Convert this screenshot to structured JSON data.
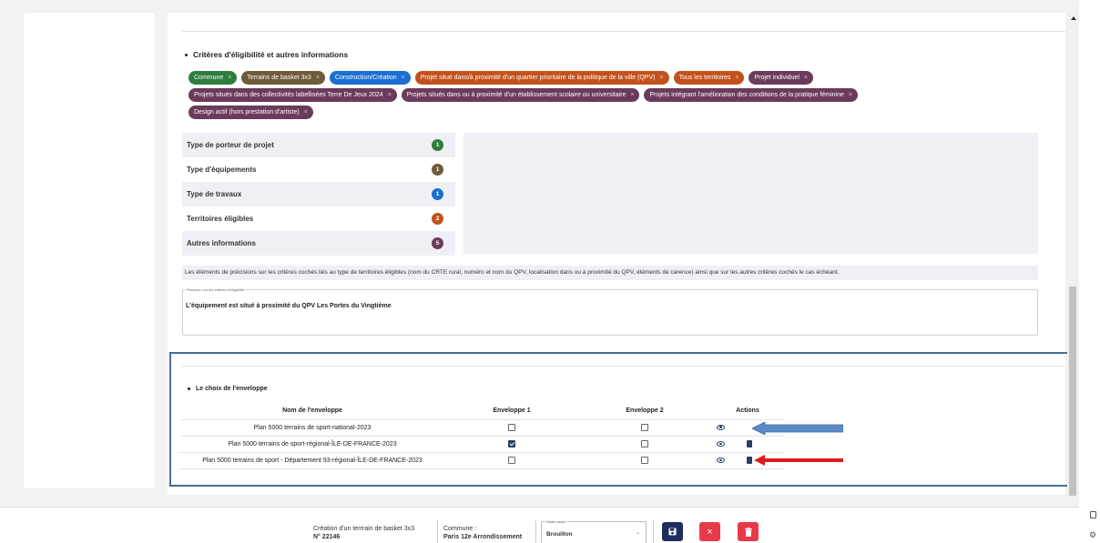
{
  "criteria_section": {
    "title": "Critères d'éligibilité et autres informations",
    "chips": [
      [
        {
          "label": "Commune",
          "color": "#2e7d3e"
        },
        {
          "label": "Terrains de basket 3x3",
          "color": "#6f5a3a"
        },
        {
          "label": "Construction/Création",
          "color": "#1a6fd1"
        },
        {
          "label": "Projet situé dans/à proximité d'un quartier prioritaire de la politique de la ville (QPV)",
          "color": "#c2521c"
        },
        {
          "label": "Tous les territoires",
          "color": "#c2521c"
        },
        {
          "label": "Projet individuel",
          "color": "#6b3b5b"
        }
      ],
      [
        {
          "label": "Projets situés dans des collectivités labellisées Terre De Jeux 2024",
          "color": "#6b3b5b"
        },
        {
          "label": "Projets situés dans ou à proximité d'un établissement scolaire ou universitaire",
          "color": "#6b3b5b"
        },
        {
          "label": "Projets intégrant l'amélioration des conditions de la pratique féminine",
          "color": "#6b3b5b"
        }
      ],
      [
        {
          "label": "Design actif (hors prestation d'artiste)",
          "color": "#6b3b5b"
        }
      ]
    ],
    "categories": [
      {
        "label": "Type de porteur de projet",
        "count": "1",
        "color": "#2e7d3e"
      },
      {
        "label": "Type d'équipements",
        "count": "1",
        "color": "#6f5a3a"
      },
      {
        "label": "Type de travaux",
        "count": "1",
        "color": "#1a6fd1"
      },
      {
        "label": "Territoires éligibles",
        "count": "2",
        "color": "#c2521c"
      },
      {
        "label": "Autres informations",
        "count": "5",
        "color": "#6b3b5b"
      }
    ],
    "precision_help": "Les éléments de précisions sur les critères cochés liés au type de territoires éligibles (nom du CRTE rural, numéro et nom du QPV, localisation dans ou à proximité du QPV, éléments de carence) ainsi que sur les autres critères cochés le cas échéant.",
    "precision_field_label": "Précision sur les critères d'éligibilité",
    "precision_value": "L'équipement est situé à proximité du QPV Les Portes du Vingtième"
  },
  "envelope_section": {
    "title": "Le choix de l'enveloppe",
    "columns": [
      "Nom de l'enveloppe",
      "Enveloppe 1",
      "Enveloppe 2",
      "Actions"
    ],
    "rows": [
      {
        "name": "Plan 5000 terrains de sport-national-2023",
        "env1": false,
        "env2": false,
        "has_pdf": false
      },
      {
        "name": "Plan 5000 terrains de sport-régional-ÎLE-DE-FRANCE-2023",
        "env1": true,
        "env2": false,
        "has_pdf": true
      },
      {
        "name": "Plan 5000 terrains de sport - Département 93-régional-ÎLE-DE-FRANCE-2023",
        "env1": false,
        "env2": false,
        "has_pdf": true
      }
    ]
  },
  "footer": {
    "project_title": "Création d'un terrrain de basket 3x3",
    "project_number": "N° 22146",
    "commune_label": "Commune :",
    "commune_value": "Paris 12e Arrondissement",
    "status_label": "Statut projet",
    "status_value": "Brouillon"
  },
  "colors": {
    "primary": "#1e2d5c",
    "danger": "#e8394a",
    "frame": "#4a6e94"
  }
}
